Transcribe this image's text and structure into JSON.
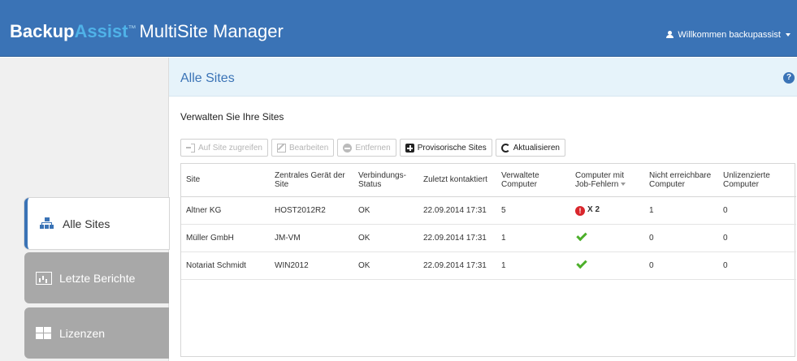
{
  "app": {
    "brand_backup": "Backup",
    "brand_assist": "Assist",
    "brand_tm": "™",
    "brand_product": "MultiSite Manager",
    "welcome": "Willkommen backupassist"
  },
  "sidebar": {
    "items": [
      {
        "label": "Alle Sites",
        "icon": "sitemap-icon",
        "active": true
      },
      {
        "label": "Letzte Berichte",
        "icon": "bar-chart-icon",
        "active": false
      },
      {
        "label": "Lizenzen",
        "icon": "grid-icon",
        "active": false
      }
    ]
  },
  "page": {
    "title": "Alle Sites",
    "section_title": "Verwalten Sie Ihre Sites"
  },
  "toolbar": {
    "access_label": "Auf Site zugreifen",
    "edit_label": "Bearbeiten",
    "remove_label": "Entfernen",
    "provisional_label": "Provisorische Sites",
    "refresh_label": "Aktualisieren"
  },
  "table": {
    "headers": [
      "Site",
      "Zentrales Gerät der Site",
      "Verbindungs-Status",
      "Zuletzt kontaktiert",
      "Verwaltete Computer",
      "Computer mit Job-Fehlern",
      "Nicht erreichbare Computer",
      "Unlizenzierte Computer"
    ],
    "rows": [
      {
        "site": "Altner KG",
        "device": "HOST2012R2",
        "status": "OK",
        "contacted": "22.09.2014 17:31",
        "managed": "5",
        "job_errors": "X 2",
        "job_error_state": "error",
        "unreachable": "1",
        "unlicensed": "0"
      },
      {
        "site": "Müller GmbH",
        "device": "JM-VM",
        "status": "OK",
        "contacted": "22.09.2014 17:31",
        "managed": "1",
        "job_errors": "",
        "job_error_state": "ok",
        "unreachable": "0",
        "unlicensed": "0"
      },
      {
        "site": "Notariat Schmidt",
        "device": "WIN2012",
        "status": "OK",
        "contacted": "22.09.2014 17:31",
        "managed": "1",
        "job_errors": "",
        "job_error_state": "ok",
        "unreachable": "0",
        "unlicensed": "0"
      }
    ]
  },
  "colors": {
    "header_bg": "#3a73b6",
    "brand_accent": "#4fb2e8",
    "title_bar_bg": "#e6f3fa",
    "error_red": "#d9262c",
    "ok_green": "#4caf2a"
  }
}
